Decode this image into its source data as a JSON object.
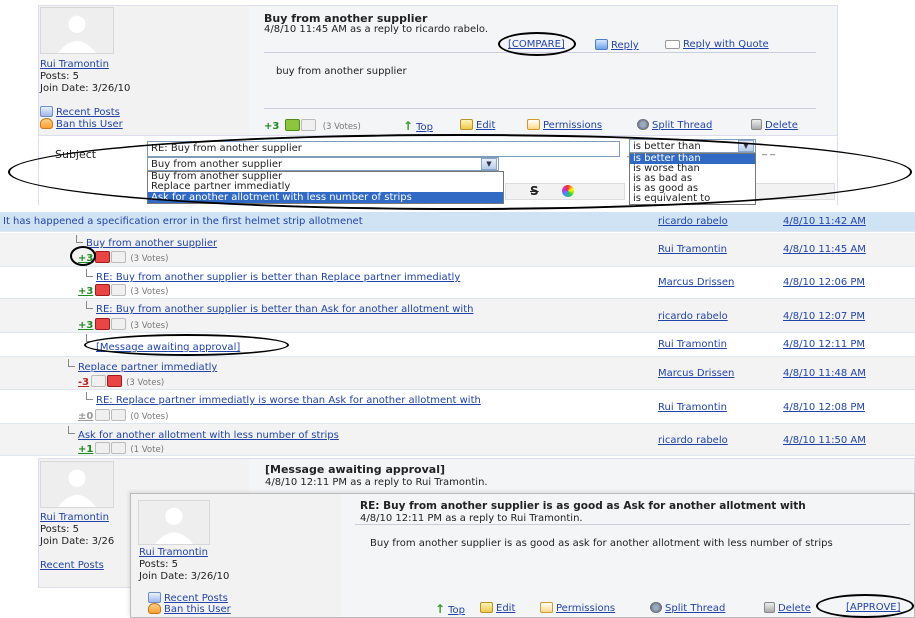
{
  "post1": {
    "title": "Buy from another supplier",
    "meta": "4/8/10 11:45 AM as a reply to ricardo rabelo.",
    "compare": "[COMPARE]",
    "reply": "Reply",
    "reply_quote": "Reply with Quote",
    "body": "buy from another supplier",
    "author": {
      "name": "Rui Tramontin",
      "posts": "Posts: 5",
      "join": "Join Date: 3/26/10",
      "recent": "Recent Posts",
      "ban": "Ban this User"
    },
    "score": "+3",
    "votes": "(3 Votes)",
    "actions": {
      "top": "Top",
      "edit": "Edit",
      "permissions": "Permissions",
      "split": "Split Thread",
      "delete": "Delete"
    }
  },
  "editor": {
    "subject_label": "Subject",
    "subject_value": "RE: Buy from another supplier",
    "dash1": "_ _",
    "dash2": "_ _",
    "target_selected": "Buy from another supplier",
    "target_options": [
      "Buy from another supplier",
      "Replace partner immediatly",
      "Ask for another allotment with less number of strips"
    ],
    "relation_selected": "is better than",
    "relation_options": [
      "is better than",
      "is worse than",
      "is as bad as",
      "is as good as",
      "is equivalent to"
    ]
  },
  "thread": {
    "header": {
      "title": "It has happened a specification error in the first helmet strip allotmenet",
      "author": "ricardo rabelo",
      "date": "4/8/10 11:42 AM"
    },
    "rows": [
      {
        "title": "Buy from another supplier",
        "score": "+3",
        "votes": "(3 Votes)",
        "author": "Rui Tramontin",
        "date": "4/8/10 11:45 AM"
      },
      {
        "title": "RE: Buy from another supplier is better than Replace partner immediatly",
        "score": "+3",
        "votes": "(3 Votes)",
        "author": "Marcus Drissen",
        "date": "4/8/10 12:06 PM"
      },
      {
        "title": "RE: Buy from another supplier is better than Ask for another allotment with",
        "score": "+3",
        "votes": "(3 Votes)",
        "author": "ricardo rabelo",
        "date": "4/8/10 12:07 PM"
      },
      {
        "title": "[Message awaiting approval]",
        "author": "Rui Tramontin",
        "date": "4/8/10 12:11 PM"
      },
      {
        "title": "Replace partner immediatly",
        "score": "-3",
        "votes": "(3 Votes)",
        "author": "Marcus Drissen",
        "date": "4/8/10 11:48 AM"
      },
      {
        "title": "RE: Replace partner immediatly is worse than Ask for another allotment with",
        "score": "±0",
        "votes": "(0 Votes)",
        "author": "Rui Tramontin",
        "date": "4/8/10 12:08 PM"
      },
      {
        "title": "Ask for another allotment with less number of strips",
        "score": "+1",
        "votes": "(1 Vote)",
        "author": "ricardo rabelo",
        "date": "4/8/10 11:50 AM"
      }
    ]
  },
  "post2": {
    "title": "[Message awaiting approval]",
    "meta": "4/8/10 12:11 PM as a reply to Rui Tramontin.",
    "author": {
      "name": "Rui Tramontin",
      "posts": "Posts: 5",
      "join": "Join Date: 3/26",
      "recent": "Recent Posts"
    }
  },
  "post3": {
    "title": "RE: Buy from another supplier is as good as Ask for another allotment with",
    "meta": "4/8/10 12:11 PM as a reply to Rui Tramontin.",
    "body": "Buy from another supplier is as good as ask for another allotment with less number of strips",
    "author": {
      "name": "Rui Tramontin",
      "posts": "Posts: 5",
      "join": "Join Date: 3/26/10",
      "recent": "Recent Posts",
      "ban": "Ban this User"
    },
    "actions": {
      "top": "Top",
      "edit": "Edit",
      "permissions": "Permissions",
      "split": "Split Thread",
      "delete": "Delete",
      "approve": "[APPROVE]"
    }
  }
}
